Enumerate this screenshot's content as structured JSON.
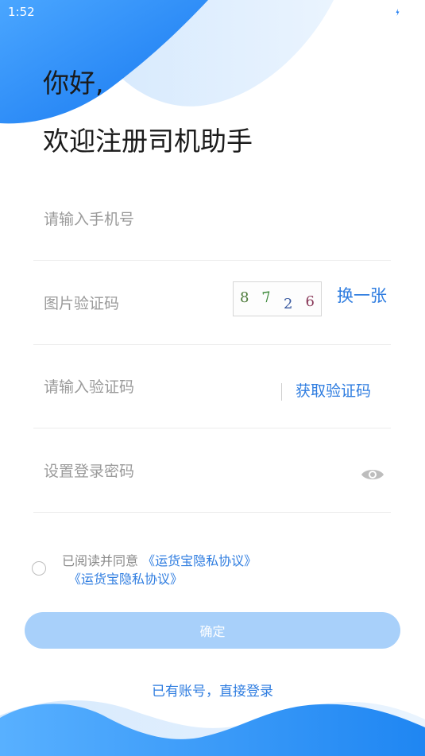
{
  "status_bar": {
    "time": "1:52",
    "icons": [
      "wifi-icon",
      "signal-icon",
      "battery-icon"
    ]
  },
  "header": {
    "greeting": "你好,",
    "welcome": "欢迎注册司机助手"
  },
  "form": {
    "phone_placeholder": "请输入手机号",
    "captcha_placeholder": "图片验证码",
    "captcha_digits": [
      "8",
      "7",
      "2",
      "6"
    ],
    "captcha_refresh_label": "换一张",
    "sms_placeholder": "请输入验证码",
    "get_code_label": "获取验证码",
    "password_placeholder": "设置登录密码"
  },
  "agreement": {
    "prefix": "已阅读并同意",
    "link1": "《运货宝隐私协议》",
    "link2": "《运货宝隐私协议》"
  },
  "confirm_label": "确定",
  "login_link": "已有账号，直接登录",
  "colors": {
    "accent": "#2f7de0",
    "button_disabled": "#a8d0fa",
    "wave_blue": "#1e88f5"
  }
}
